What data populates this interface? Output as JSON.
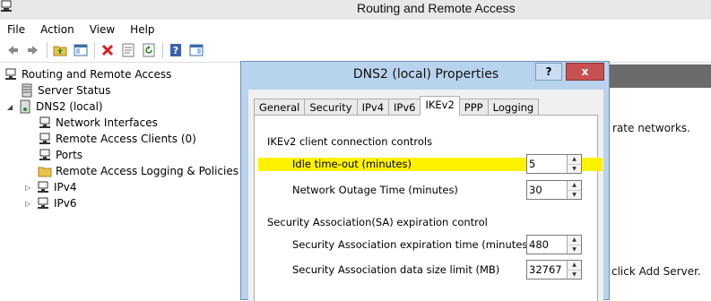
{
  "window": {
    "title": "Routing and Remote Access"
  },
  "menu": {
    "items": [
      "File",
      "Action",
      "View",
      "Help"
    ]
  },
  "toolbar": {
    "buttons": [
      "back-icon",
      "forward-icon",
      "folder-up-icon",
      "show-hide-tree-icon",
      "delete-icon",
      "properties-icon",
      "refresh-icon",
      "help-icon",
      "console-icon"
    ]
  },
  "tree": {
    "root": "Routing and Remote Access",
    "server_status": "Server Status",
    "server": "DNS2 (local)",
    "children": [
      "Network Interfaces",
      "Remote Access Clients (0)",
      "Ports",
      "Remote Access Logging & Policies",
      "IPv4",
      "IPv6"
    ]
  },
  "right_pane": {
    "text1": "rate networks.",
    "text2": "click Add Server."
  },
  "dialog": {
    "title": "DNS2 (local) Properties",
    "help_label": "?",
    "close_label": "x",
    "tabs": [
      "General",
      "Security",
      "IPv4",
      "IPv6",
      "IKEv2",
      "PPP",
      "Logging"
    ],
    "active_tab": "IKEv2",
    "section1": "IKEv2 client connection controls",
    "idle_label": "Idle time-out (minutes)",
    "idle_value": "5",
    "outage_label": "Network Outage Time (minutes)",
    "outage_value": "30",
    "section2": "Security Association(SA) expiration control",
    "sa_time_label": "Security Association expiration time (minutes)",
    "sa_time_value": "480",
    "sa_size_label": "Security Association data size limit (MB)",
    "sa_size_value": "32767"
  },
  "colors": {
    "highlight": "#fff200",
    "dialog_frame": "#b8d3ee",
    "close_button": "#c75050",
    "selection": "#3399ff"
  }
}
